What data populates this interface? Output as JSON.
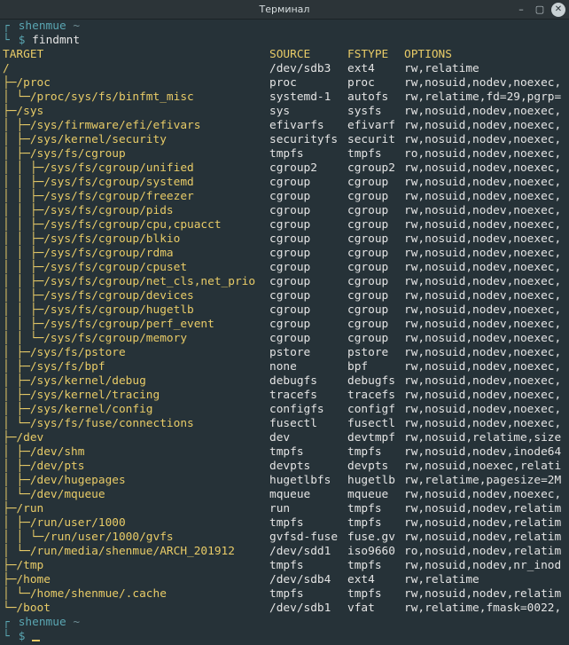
{
  "window": {
    "title": "Терминал",
    "btn_minimize": "–",
    "btn_maximize": "▢",
    "btn_close": "✕"
  },
  "prompt1": {
    "corner1": "┌",
    "user": "shenmue",
    "tilde": "~",
    "corner2": "└",
    "dollar": "$",
    "command": "findmnt"
  },
  "header": {
    "target": "TARGET",
    "source": "SOURCE",
    "fstype": "FSTYPE",
    "options": "OPTIONS"
  },
  "rows": [
    {
      "target": "/",
      "source": "/dev/sdb3",
      "fstype": "ext4",
      "options": "rw,relatime"
    },
    {
      "target": "├─/proc",
      "source": "proc",
      "fstype": "proc",
      "options": "rw,nosuid,nodev,noexec,"
    },
    {
      "target": "│ └─/proc/sys/fs/binfmt_misc",
      "source": "systemd-1",
      "fstype": "autofs",
      "options": "rw,relatime,fd=29,pgrp="
    },
    {
      "target": "├─/sys",
      "source": "sys",
      "fstype": "sysfs",
      "options": "rw,nosuid,nodev,noexec,"
    },
    {
      "target": "│ ├─/sys/firmware/efi/efivars",
      "source": "efivarfs",
      "fstype": "efivarf",
      "options": "rw,nosuid,nodev,noexec,"
    },
    {
      "target": "│ ├─/sys/kernel/security",
      "source": "securityfs",
      "fstype": "securit",
      "options": "rw,nosuid,nodev,noexec,"
    },
    {
      "target": "│ ├─/sys/fs/cgroup",
      "source": "tmpfs",
      "fstype": "tmpfs",
      "options": "ro,nosuid,nodev,noexec,"
    },
    {
      "target": "│ │ ├─/sys/fs/cgroup/unified",
      "source": "cgroup2",
      "fstype": "cgroup2",
      "options": "rw,nosuid,nodev,noexec,"
    },
    {
      "target": "│ │ ├─/sys/fs/cgroup/systemd",
      "source": "cgroup",
      "fstype": "cgroup",
      "options": "rw,nosuid,nodev,noexec,"
    },
    {
      "target": "│ │ ├─/sys/fs/cgroup/freezer",
      "source": "cgroup",
      "fstype": "cgroup",
      "options": "rw,nosuid,nodev,noexec,"
    },
    {
      "target": "│ │ ├─/sys/fs/cgroup/pids",
      "source": "cgroup",
      "fstype": "cgroup",
      "options": "rw,nosuid,nodev,noexec,"
    },
    {
      "target": "│ │ ├─/sys/fs/cgroup/cpu,cpuacct",
      "source": "cgroup",
      "fstype": "cgroup",
      "options": "rw,nosuid,nodev,noexec,"
    },
    {
      "target": "│ │ ├─/sys/fs/cgroup/blkio",
      "source": "cgroup",
      "fstype": "cgroup",
      "options": "rw,nosuid,nodev,noexec,"
    },
    {
      "target": "│ │ ├─/sys/fs/cgroup/rdma",
      "source": "cgroup",
      "fstype": "cgroup",
      "options": "rw,nosuid,nodev,noexec,"
    },
    {
      "target": "│ │ ├─/sys/fs/cgroup/cpuset",
      "source": "cgroup",
      "fstype": "cgroup",
      "options": "rw,nosuid,nodev,noexec,"
    },
    {
      "target": "│ │ ├─/sys/fs/cgroup/net_cls,net_prio",
      "source": "cgroup",
      "fstype": "cgroup",
      "options": "rw,nosuid,nodev,noexec,"
    },
    {
      "target": "│ │ ├─/sys/fs/cgroup/devices",
      "source": "cgroup",
      "fstype": "cgroup",
      "options": "rw,nosuid,nodev,noexec,"
    },
    {
      "target": "│ │ ├─/sys/fs/cgroup/hugetlb",
      "source": "cgroup",
      "fstype": "cgroup",
      "options": "rw,nosuid,nodev,noexec,"
    },
    {
      "target": "│ │ ├─/sys/fs/cgroup/perf_event",
      "source": "cgroup",
      "fstype": "cgroup",
      "options": "rw,nosuid,nodev,noexec,"
    },
    {
      "target": "│ │ └─/sys/fs/cgroup/memory",
      "source": "cgroup",
      "fstype": "cgroup",
      "options": "rw,nosuid,nodev,noexec,"
    },
    {
      "target": "│ ├─/sys/fs/pstore",
      "source": "pstore",
      "fstype": "pstore",
      "options": "rw,nosuid,nodev,noexec,"
    },
    {
      "target": "│ ├─/sys/fs/bpf",
      "source": "none",
      "fstype": "bpf",
      "options": "rw,nosuid,nodev,noexec,"
    },
    {
      "target": "│ ├─/sys/kernel/debug",
      "source": "debugfs",
      "fstype": "debugfs",
      "options": "rw,nosuid,nodev,noexec,"
    },
    {
      "target": "│ ├─/sys/kernel/tracing",
      "source": "tracefs",
      "fstype": "tracefs",
      "options": "rw,nosuid,nodev,noexec,"
    },
    {
      "target": "│ ├─/sys/kernel/config",
      "source": "configfs",
      "fstype": "configf",
      "options": "rw,nosuid,nodev,noexec,"
    },
    {
      "target": "│ └─/sys/fs/fuse/connections",
      "source": "fusectl",
      "fstype": "fusectl",
      "options": "rw,nosuid,nodev,noexec,"
    },
    {
      "target": "├─/dev",
      "source": "dev",
      "fstype": "devtmpf",
      "options": "rw,nosuid,relatime,size"
    },
    {
      "target": "│ ├─/dev/shm",
      "source": "tmpfs",
      "fstype": "tmpfs",
      "options": "rw,nosuid,nodev,inode64"
    },
    {
      "target": "│ ├─/dev/pts",
      "source": "devpts",
      "fstype": "devpts",
      "options": "rw,nosuid,noexec,relati"
    },
    {
      "target": "│ ├─/dev/hugepages",
      "source": "hugetlbfs",
      "fstype": "hugetlb",
      "options": "rw,relatime,pagesize=2M"
    },
    {
      "target": "│ └─/dev/mqueue",
      "source": "mqueue",
      "fstype": "mqueue",
      "options": "rw,nosuid,nodev,noexec,"
    },
    {
      "target": "├─/run",
      "source": "run",
      "fstype": "tmpfs",
      "options": "rw,nosuid,nodev,relatim"
    },
    {
      "target": "│ ├─/run/user/1000",
      "source": "tmpfs",
      "fstype": "tmpfs",
      "options": "rw,nosuid,nodev,relatim"
    },
    {
      "target": "│ │ └─/run/user/1000/gvfs",
      "source": "gvfsd-fuse",
      "fstype": "fuse.gv",
      "options": "rw,nosuid,nodev,relatim"
    },
    {
      "target": "│ └─/run/media/shenmue/ARCH_201912",
      "source": "/dev/sdd1",
      "fstype": "iso9660",
      "options": "ro,nosuid,nodev,relatim"
    },
    {
      "target": "├─/tmp",
      "source": "tmpfs",
      "fstype": "tmpfs",
      "options": "rw,nosuid,nodev,nr_inod"
    },
    {
      "target": "├─/home",
      "source": "/dev/sdb4",
      "fstype": "ext4",
      "options": "rw,relatime"
    },
    {
      "target": "│ └─/home/shenmue/.cache",
      "source": "tmpfs",
      "fstype": "tmpfs",
      "options": "rw,nosuid,nodev,relatim"
    },
    {
      "target": "└─/boot",
      "source": "/dev/sdb1",
      "fstype": "vfat",
      "options": "rw,relatime,fmask=0022,"
    }
  ],
  "prompt2": {
    "corner1": "┌",
    "user": "shenmue",
    "tilde": "~",
    "corner2": "└",
    "dollar": "$"
  },
  "colors": {
    "background": "#263238",
    "accent": "#e8cb67",
    "prompt": "#5aa6b2",
    "text": "#e4e4e4"
  }
}
